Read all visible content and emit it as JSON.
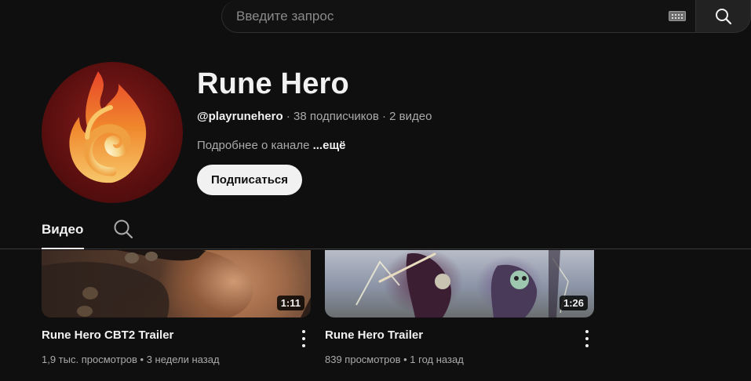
{
  "search": {
    "placeholder": "Введите запрос",
    "icon": "search-icon",
    "keyboard_icon": "keyboard-icon"
  },
  "channel": {
    "name": "Rune Hero",
    "handle": "@playrunehero",
    "subscribers": "38 подписчиков",
    "video_count": "2 видео",
    "separator": " · ",
    "description": "Подробнее о канале ",
    "more_label": "...ещё",
    "subscribe_label": "Подписаться",
    "avatar_icon": "flame-logo"
  },
  "tabs": {
    "videos_label": "Видео",
    "search_icon": "search-icon"
  },
  "videos": [
    {
      "title": "Rune Hero CBT2 Trailer",
      "duration": "1:11",
      "views": "1,9 тыс. просмотров",
      "age": "3 недели назад"
    },
    {
      "title": "Rune Hero Trailer",
      "duration": "1:26",
      "views": "839 просмотров",
      "age": "1 год назад"
    }
  ],
  "colors": {
    "background": "#0f0f0f",
    "text_primary": "#f1f1f1",
    "text_secondary": "#aaaaaa",
    "subscribe_bg": "#f1f1f1"
  }
}
